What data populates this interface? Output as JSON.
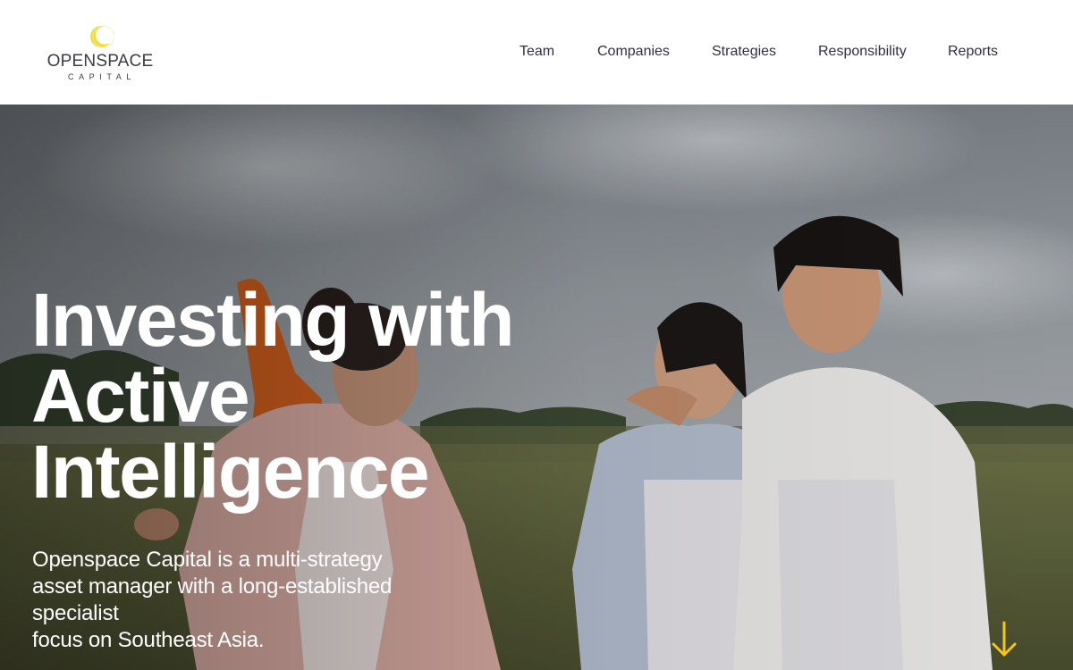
{
  "brand": {
    "name": "OPENSPACE",
    "sub": "CAPITAL",
    "mark_icon": "crescent-logo-icon",
    "accent_color": "#f2dc3c"
  },
  "nav": {
    "items": [
      {
        "label": "Team"
      },
      {
        "label": "Companies"
      },
      {
        "label": "Strategies"
      },
      {
        "label": "Responsibility"
      },
      {
        "label": "Reports"
      }
    ]
  },
  "hero": {
    "title_lines": [
      "Investing with",
      "Active",
      "Intelligence"
    ],
    "subtitle_lines": [
      "Openspace Capital is a multi-strategy",
      "asset manager with a long-established",
      "specialist",
      "focus on Southeast Asia."
    ],
    "background": "photo-four-women-walking-in-field",
    "scroll_icon": "arrow-down-icon",
    "scroll_color": "#f5c518"
  }
}
